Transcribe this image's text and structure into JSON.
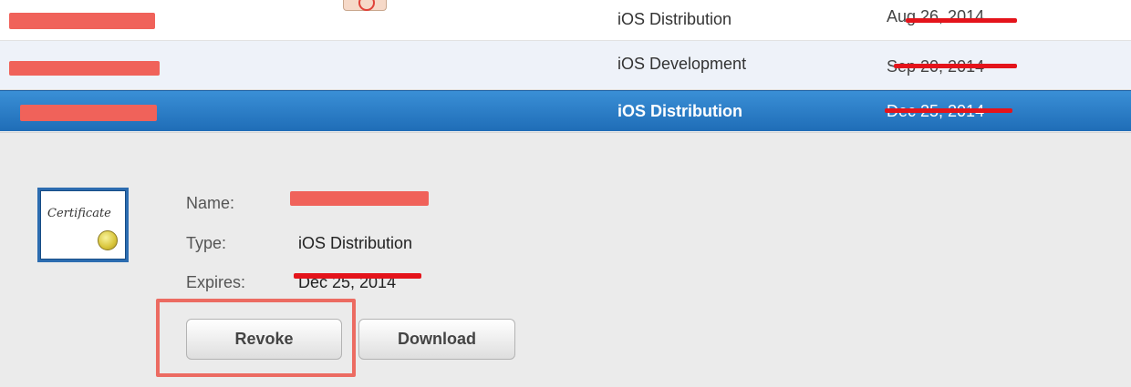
{
  "certificates": [
    {
      "type": "iOS Distribution",
      "expires": "Aug 26, 2014"
    },
    {
      "type": "iOS Development",
      "expires": "Sep 20, 2014"
    },
    {
      "type": "iOS Distribution",
      "expires": "Dec 25, 2014",
      "selected": true
    }
  ],
  "details": {
    "name_label": "Name:",
    "type_label": "Type:",
    "type_value": "iOS Distribution",
    "expires_label": "Expires:",
    "expires_value": "Dec 25, 2014",
    "icon_text": "Certificate"
  },
  "buttons": {
    "revoke": "Revoke",
    "download": "Download"
  },
  "colors": {
    "selected_row": "#2a7dc8",
    "alt_row": "#eef2f9",
    "redaction": "#f0625a",
    "highlight_box": "#ec6b62"
  },
  "icons": {
    "certificate": "certificate-icon",
    "top_badge": "badge-icon"
  }
}
